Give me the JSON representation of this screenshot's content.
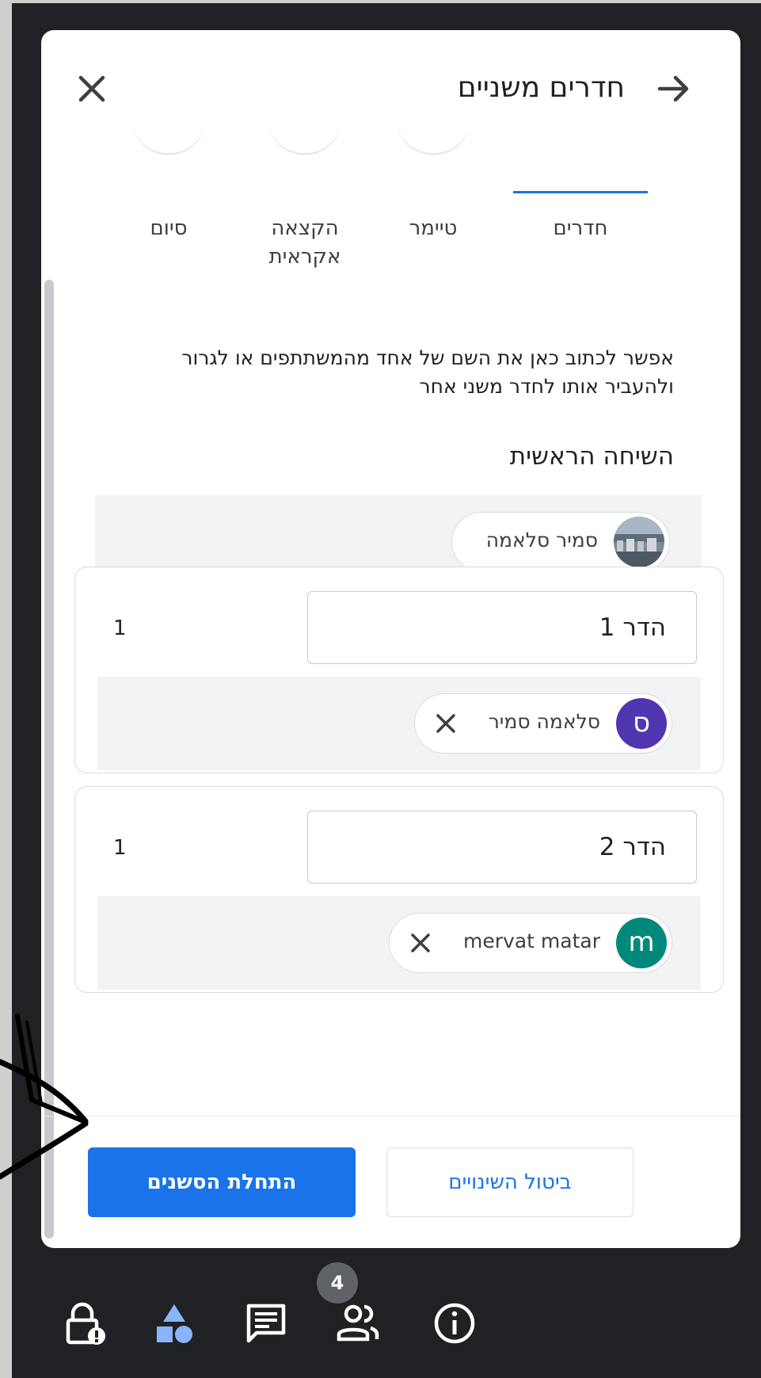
{
  "panel": {
    "title": "חדרים משניים",
    "back_icon": "arrow-right-icon",
    "close_icon": "close-icon"
  },
  "tabs": [
    {
      "label": "חדרים",
      "active": true
    },
    {
      "label": "טיימר",
      "active": false
    },
    {
      "label": "הקצאה אקראית",
      "active": false
    },
    {
      "label": "סיום",
      "active": false
    }
  ],
  "hint": "אפשר לכתוב כאן את השם של אחד מהמשתתפים או לגרור ולהעביר אותו לחדר משני אחר",
  "main_conversation": {
    "title": "השיחה הראשית",
    "participants": [
      {
        "name": "סמיר סלאמה",
        "avatar": "photo"
      }
    ]
  },
  "rooms": [
    {
      "name": "הדר 1",
      "count": "1",
      "participants": [
        {
          "name": "סלאמה סמיר",
          "initial": "ס",
          "color": "#5135b0"
        }
      ]
    },
    {
      "name": "הדר 2",
      "count": "1",
      "participants": [
        {
          "name": "mervat matar",
          "initial": "m",
          "color": "#00897b"
        }
      ]
    }
  ],
  "footer": {
    "start_label": "התחלת הסשנים",
    "cancel_label": "ביטול השינויים",
    "accent": "#1a73e8"
  },
  "toolbar": {
    "icons": [
      "host-controls-icon",
      "activities-icon",
      "chat-icon",
      "people-icon",
      "info-icon"
    ],
    "people_badge": "4"
  }
}
